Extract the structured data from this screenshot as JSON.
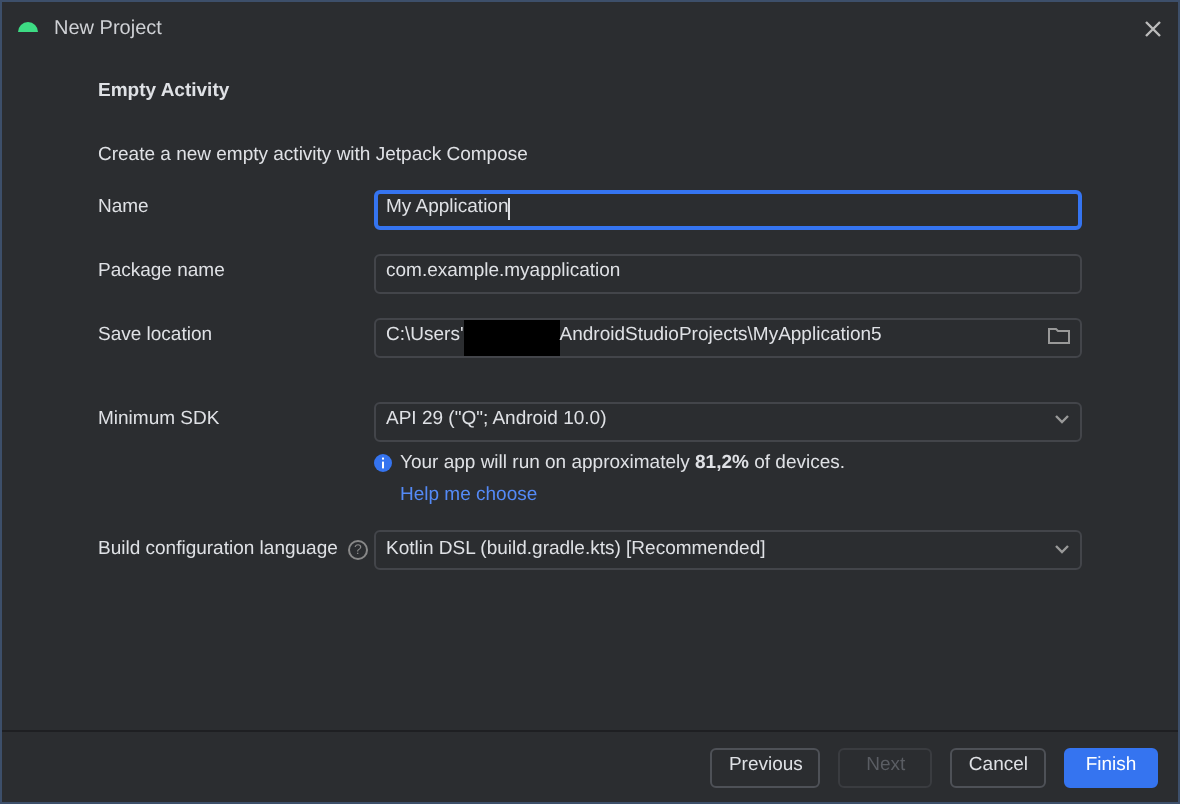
{
  "window": {
    "title": "New Project"
  },
  "header": {
    "title": "Empty Activity",
    "description": "Create a new empty activity with Jetpack Compose"
  },
  "fields": [
    {
      "kind": "text",
      "label": "Name",
      "value": "My Application",
      "focused": true
    },
    {
      "kind": "text",
      "label": "Package name",
      "value": "com.example.myapplication",
      "focused": false
    },
    {
      "kind": "path",
      "label": "Save location",
      "value_start": "C:\\Users'",
      "value_end": "AndroidStudioProjects\\MyApplication5",
      "focused": false
    },
    {
      "kind": "dropdown",
      "label": "Minimum SDK",
      "value": "API 29 (\"Q\"; Android 10.0)",
      "note": "Your app will run on approximately **81,2%** of devices.",
      "link": "Help me choose"
    },
    {
      "kind": "dropdown",
      "label": "Build configuration language",
      "value": "Kotlin DSL (build.gradle.kts) [Recommended]",
      "help": "?"
    }
  ],
  "buttons": [
    {
      "label": "Previous",
      "kind": "default",
      "disabled": false
    },
    {
      "label": "Next",
      "kind": "default",
      "disabled": true
    },
    {
      "label": "Cancel",
      "kind": "default",
      "disabled": false
    },
    {
      "label": "Finish",
      "kind": "primary",
      "disabled": false
    }
  ]
}
